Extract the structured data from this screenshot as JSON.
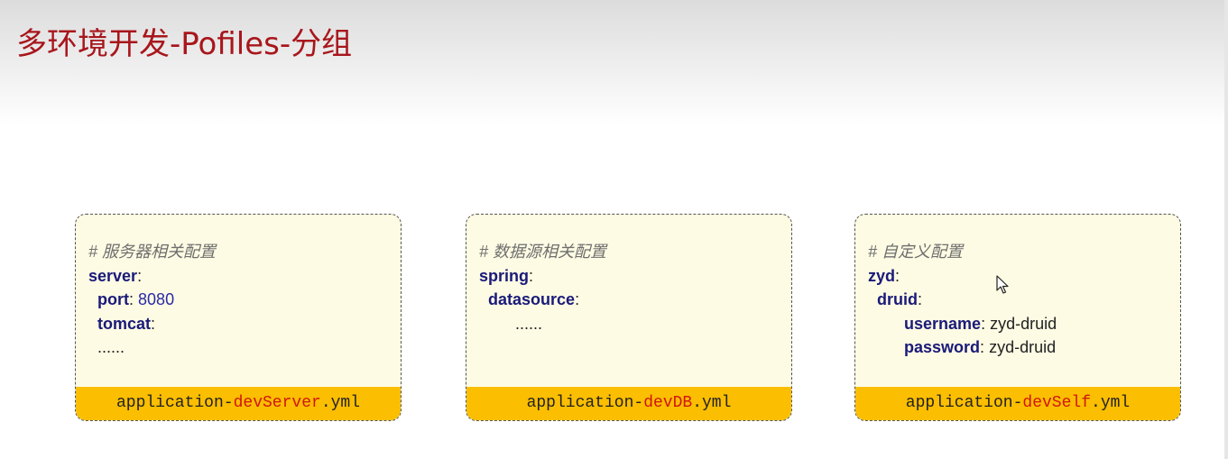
{
  "slide": {
    "title": "多环境开发-Pofiles-分组"
  },
  "cards": [
    {
      "lines": [
        {
          "comment": "# 服务器相关配置"
        },
        {
          "key": "server",
          "sep": ":"
        },
        {
          "indent": "  ",
          "key": "port",
          "sep": ": ",
          "value": "8080",
          "value_type": "number"
        },
        {
          "indent": "  ",
          "key": "tomcat",
          "sep": ":"
        },
        {
          "indent": "  ",
          "text": "......"
        }
      ],
      "file": {
        "prefix": "application-",
        "name": "devServer",
        "suffix": ".yml"
      }
    },
    {
      "lines": [
        {
          "comment": "# 数据源相关配置"
        },
        {
          "key": "spring",
          "sep": ":"
        },
        {
          "indent": "  ",
          "key": "datasource",
          "sep": ":"
        },
        {
          "indent": "        ",
          "text": "......"
        }
      ],
      "file": {
        "prefix": "application-",
        "name": "devDB",
        "suffix": ".yml"
      }
    },
    {
      "lines": [
        {
          "comment": "# 自定义配置"
        },
        {
          "key": "zyd",
          "sep": ":"
        },
        {
          "indent": "  ",
          "key": "druid",
          "sep": ":"
        },
        {
          "indent": "        ",
          "key": "username",
          "sep": ": ",
          "value": "zyd-druid",
          "value_type": "string"
        },
        {
          "indent": "        ",
          "key": "password",
          "sep": ": ",
          "value": "zyd-druid",
          "value_type": "string"
        }
      ],
      "file": {
        "prefix": "application-",
        "name": "devSelf",
        "suffix": ".yml"
      }
    }
  ],
  "colors": {
    "title": "#a8161c",
    "card_background": "#fdfbe3",
    "footer_background": "#fbbe00",
    "filename_highlight": "#d0160e",
    "yaml_key": "#1a1a7a"
  },
  "icons": {
    "cursor": "mouse-pointer-icon"
  }
}
